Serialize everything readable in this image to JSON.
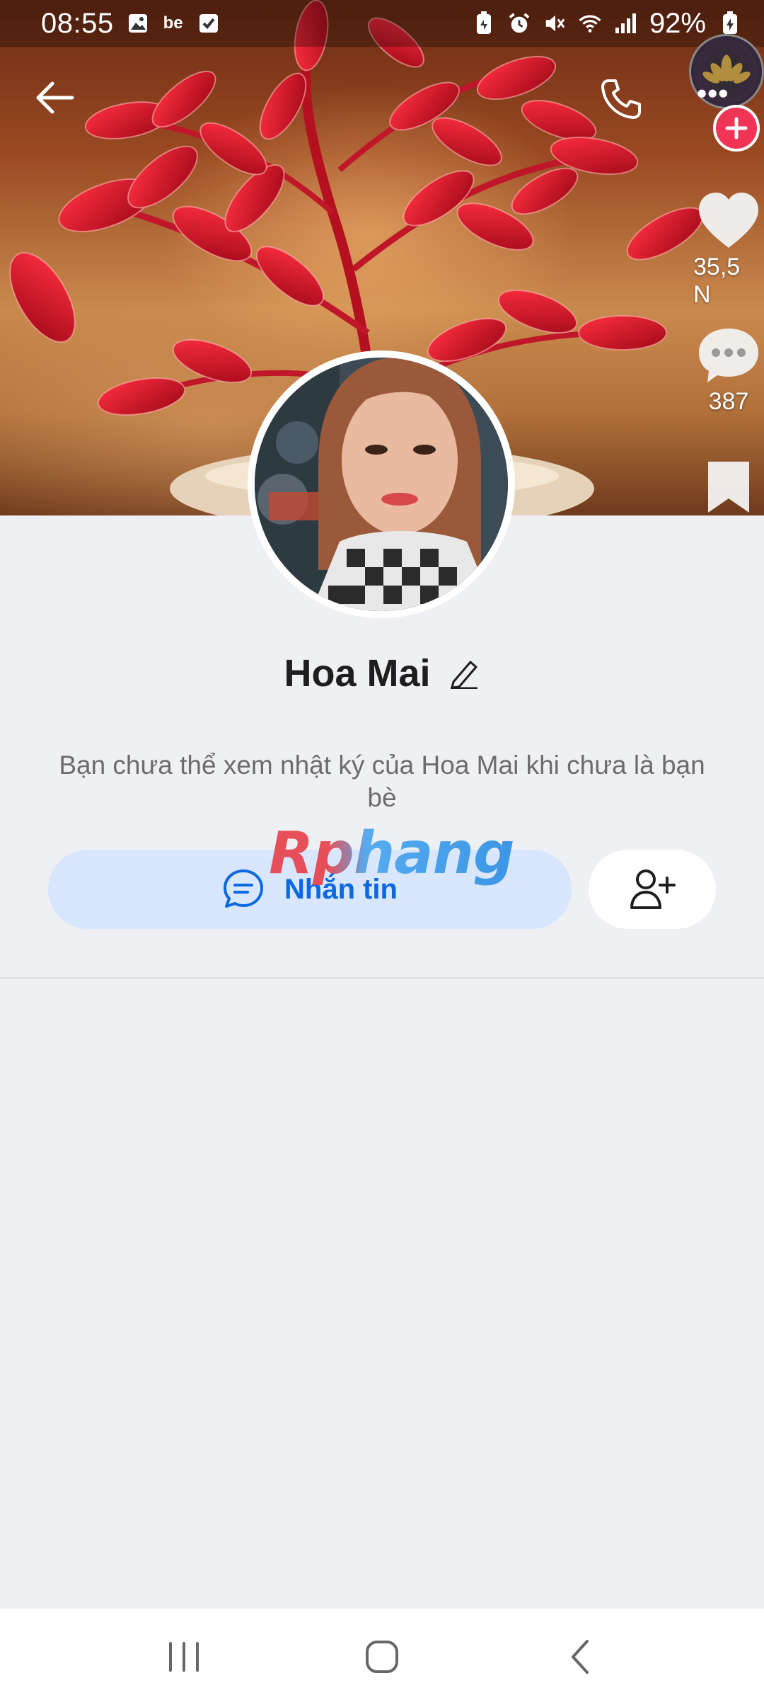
{
  "status_bar": {
    "time": "08:55",
    "left_icons": [
      "gallery-icon",
      "be-app-icon",
      "checkbox-icon"
    ],
    "be_label": "be",
    "right_icons": [
      "battery-saver-icon",
      "alarm-icon",
      "mute-icon",
      "wifi-icon",
      "signal-icon",
      "charging-icon"
    ],
    "battery": "92%"
  },
  "header": {
    "back_icon": "arrow-left-icon",
    "call_icon": "phone-icon",
    "more_icon": "more-dots-icon"
  },
  "side_stats": {
    "likes": "35,5 N",
    "comments": "387"
  },
  "profile": {
    "name": "Hoa Mai",
    "notice": "Bạn chưa thể xem nhật ký của Hoa Mai khi chưa là bạn bè"
  },
  "actions": {
    "message_label": "Nhắn tin",
    "add_friend_icon": "add-person-icon"
  },
  "watermark": "Rphang",
  "colors": {
    "accent": "#0a68e0",
    "message_button_bg": "#d8e7fd",
    "page_bg": "#eff0f4",
    "badge_red": "#f03455"
  },
  "nav_bar": {
    "items": [
      "recent-apps-icon",
      "home-icon",
      "back-icon"
    ]
  }
}
